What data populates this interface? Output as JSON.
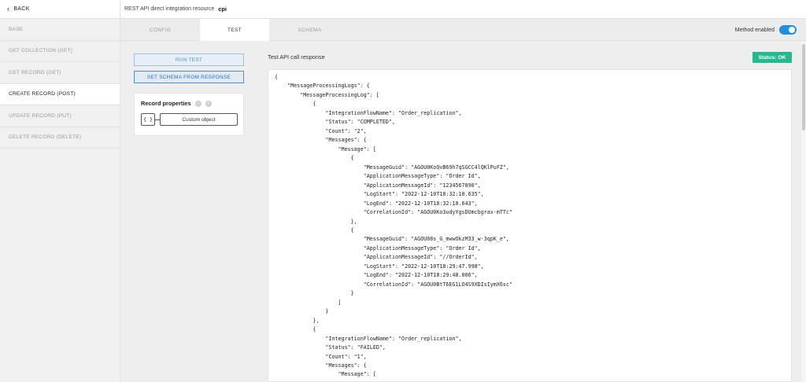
{
  "sidebar": {
    "back_label": "BACK",
    "items": [
      {
        "label": "BASE"
      },
      {
        "label": "GET COLLECTION (GET)"
      },
      {
        "label": "GET RECORD (GET)"
      },
      {
        "label": "CREATE RECORD (POST)",
        "active": true
      },
      {
        "label": "UPDATE RECORD (PUT)"
      },
      {
        "label": "DELETE RECORD (DELETE)"
      }
    ]
  },
  "header": {
    "title": "REST API direct integration resource",
    "resource_name": "cpi"
  },
  "tabs": [
    {
      "label": "CONFIG"
    },
    {
      "label": "TEST",
      "active": true
    },
    {
      "label": "SCHEMA"
    }
  ],
  "method_toggle": {
    "label": "Method enabled",
    "enabled": true
  },
  "actions": {
    "run_test": "RUN TEST",
    "set_schema": "SET SCHEMA FROM RESPONSE"
  },
  "record_properties": {
    "title": "Record properties",
    "braces": "{ }",
    "type_label": "Custom object"
  },
  "response": {
    "label": "Test API call response",
    "status": "Status: OK",
    "code_lines": [
      "{",
      "    \"MessageProcessingLogs\": {",
      "        \"MessageProcessingLog\": [",
      "            {",
      "                \"IntegrationFlowName\": \"Order_replication\",",
      "                \"Status\": \"COMPLETED\",",
      "                \"Count\": \"2\",",
      "                \"Messages\": {",
      "                    \"Message\": [",
      "                        {",
      "                            \"MessageGuid\": \"AGOU0KoQvB69h7qSGCC4lQKlPuFZ\",",
      "                            \"ApplicationMessageType\": \"Order Id\",",
      "                            \"ApplicationMessageId\": \"1234567890\",",
      "                            \"LogStart\": \"2022-12-10T18:32:10.635\",",
      "                            \"LogEnd\": \"2022-12-10T18:32:10.643\",",
      "                            \"CorrelationId\": \"AGOU0Ko3udyYgsDUmcbgrax-mTTc\"",
      "                        },",
      "                        {",
      "                            \"MessageGuid\": \"AGOU08s_G_mwwOkzM33_w-3qpK_e\",",
      "                            \"ApplicationMessageType\": \"Order Id\",",
      "                            \"ApplicationMessageId\": \"//OrderId\",",
      "                            \"LogStart\": \"2022-12-10T18:29:47.998\",",
      "                            \"LogEnd\": \"2022-12-10T18:29:48.006\",",
      "                            \"CorrelationId\": \"AGOU0BtT6EG1LO4S9XDIsIymX6sc\"",
      "                        }",
      "                    ]",
      "                }",
      "            },",
      "            {",
      "                \"IntegrationFlowName\": \"Order_replication\",",
      "                \"Status\": \"FAILED\",",
      "                \"Count\": \"1\",",
      "                \"Messages\": {",
      "                    \"Message\": ["
    ]
  },
  "colors": {
    "accent": "#1f8fe0",
    "status_ok": "#26b88e",
    "button_border": "#4a90d9"
  }
}
